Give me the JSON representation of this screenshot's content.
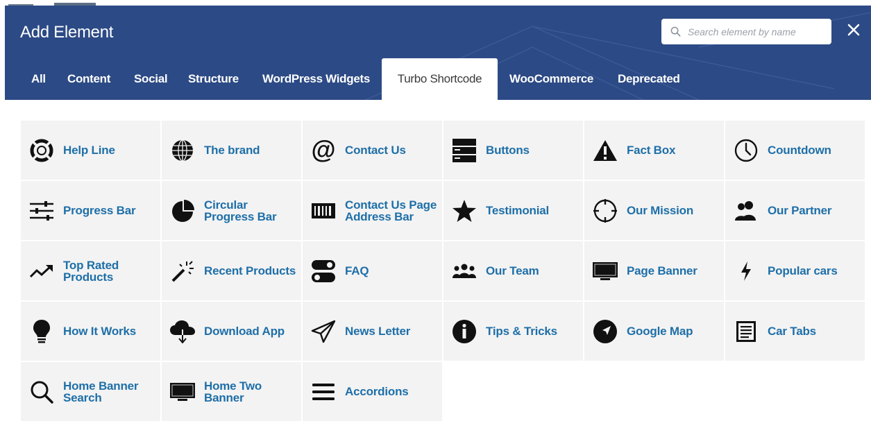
{
  "modal": {
    "title": "Add Element",
    "search": {
      "placeholder": "Search element by name",
      "value": ""
    },
    "close_glyph": "✕"
  },
  "tabs": [
    {
      "label": "All"
    },
    {
      "label": "Content"
    },
    {
      "label": "Social"
    },
    {
      "label": "Structure"
    },
    {
      "label": "WordPress Widgets"
    },
    {
      "label": "Turbo Shortcode",
      "active": true
    },
    {
      "label": "WooCommerce"
    },
    {
      "label": "Deprecated"
    }
  ],
  "elements": [
    {
      "label": "Help Line",
      "icon": "lifebuoy-icon"
    },
    {
      "label": "The brand",
      "icon": "globe-icon"
    },
    {
      "label": "Contact Us",
      "icon": "at-sign-icon"
    },
    {
      "label": "Buttons",
      "icon": "server-stack-icon"
    },
    {
      "label": "Fact Box",
      "icon": "warning-triangle-icon"
    },
    {
      "label": "Countdown",
      "icon": "clock-icon"
    },
    {
      "label": "Progress Bar",
      "icon": "sliders-icon"
    },
    {
      "label": "Circular Progress Bar",
      "icon": "pie-chart-icon"
    },
    {
      "label": "Contact Us Page Address Bar",
      "icon": "barcode-icon"
    },
    {
      "label": "Testimonial",
      "icon": "star-icon"
    },
    {
      "label": "Our Mission",
      "icon": "crosshair-icon"
    },
    {
      "label": "Our Partner",
      "icon": "users-icon"
    },
    {
      "label": "Top Rated Products",
      "icon": "trending-up-icon"
    },
    {
      "label": "Recent Products",
      "icon": "magic-wand-icon"
    },
    {
      "label": "FAQ",
      "icon": "toggles-icon"
    },
    {
      "label": "Our Team",
      "icon": "group-icon"
    },
    {
      "label": "Page Banner",
      "icon": "monitor-icon"
    },
    {
      "label": "Popular cars",
      "icon": "bolt-icon"
    },
    {
      "label": "How It Works",
      "icon": "lightbulb-icon"
    },
    {
      "label": "Download App",
      "icon": "cloud-download-icon"
    },
    {
      "label": "News Letter",
      "icon": "paper-plane-icon"
    },
    {
      "label": "Tips & Tricks",
      "icon": "info-circle-icon"
    },
    {
      "label": "Google Map",
      "icon": "navigation-icon"
    },
    {
      "label": "Car Tabs",
      "icon": "document-icon"
    },
    {
      "label": "Home Banner Search",
      "icon": "search-icon"
    },
    {
      "label": "Home Two Banner",
      "icon": "monitor-icon"
    },
    {
      "label": "Accordions",
      "icon": "menu-lines-icon"
    }
  ],
  "colors": {
    "header_bg": "#2c4a85",
    "tab_active_bg": "#ffffff",
    "tile_bg": "#f3f3f3",
    "label_color": "#1e6fa8",
    "icon_color": "#111111"
  }
}
